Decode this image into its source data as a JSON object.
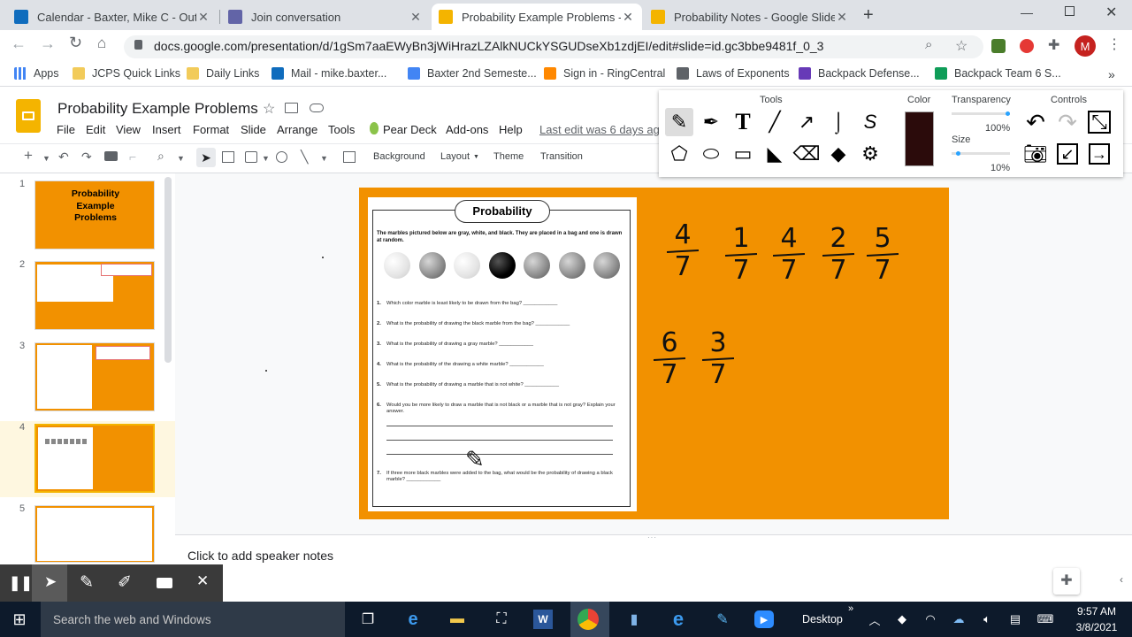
{
  "browser": {
    "tabs": [
      {
        "title": "Calendar - Baxter, Mike C - Outlo",
        "icon_color": "#0f6cbd"
      },
      {
        "title": "Join conversation",
        "icon_color": "#6264a7"
      },
      {
        "title": "Probability Example Problems - G",
        "icon_color": "#f4b400"
      },
      {
        "title": "Probability Notes - Google Slides",
        "icon_color": "#f4b400"
      }
    ],
    "new_tab": "+",
    "url": "docs.google.com/presentation/d/1gSm7aaEWyBn3jWiHrazLZAlkNUCkYSGUDseXb1zdjEI/edit#slide=id.gc3bbe9481f_0_3",
    "profile_initial": "M",
    "bookmarks": [
      {
        "label": "Apps",
        "icon": "apps-grid-icon"
      },
      {
        "label": "JCPS Quick Links",
        "icon": "folder-icon"
      },
      {
        "label": "Daily Links",
        "icon": "folder-icon"
      },
      {
        "label": "Mail - mike.baxter...",
        "icon": "outlook-icon"
      },
      {
        "label": "Baxter 2nd Semeste...",
        "icon": "docs-icon"
      },
      {
        "label": "Sign in - RingCentral",
        "icon": "ringcentral-icon"
      },
      {
        "label": "Laws of Exponents",
        "icon": "pearson-icon"
      },
      {
        "label": "Backpack Defense...",
        "icon": "forms-icon"
      },
      {
        "label": "Backpack Team 6 S...",
        "icon": "sheets-icon"
      }
    ],
    "more": "»"
  },
  "slides": {
    "doc_title": "Probability Example Problems",
    "menus": [
      "File",
      "Edit",
      "View",
      "Insert",
      "Format",
      "Slide",
      "Arrange",
      "Tools",
      "Pear Deck",
      "Add-ons",
      "Help"
    ],
    "last_edit": "Last edit was 6 days ago",
    "toolbar_text_buttons": [
      "Background",
      "Layout",
      "Theme",
      "Transition"
    ],
    "filmstrip": [
      {
        "num": "1",
        "title": "Probability Example Problems"
      },
      {
        "num": "2"
      },
      {
        "num": "3"
      },
      {
        "num": "4"
      },
      {
        "num": "5"
      }
    ],
    "speaker_notes_placeholder": "Click to add speaker notes",
    "worksheet": {
      "title": "Probability",
      "intro": "The marbles pictured below are gray, white, and black.  They are placed in a bag and one is drawn at random.",
      "marbles": [
        "white",
        "gray",
        "white",
        "black",
        "gray",
        "gray",
        "gray"
      ],
      "questions": [
        {
          "n": "1.",
          "text": "Which color marble is least likely to be drawn from the bag? ____________"
        },
        {
          "n": "2.",
          "text": "What is the probability of drawing the black marble from the bag? ____________"
        },
        {
          "n": "3.",
          "text": "What is the probability of drawing a gray marble? ____________"
        },
        {
          "n": "4.",
          "text": "What is the probability of the drawing a white marble? ____________"
        },
        {
          "n": "5.",
          "text": "What is the probability of drawing a marble that is not white? ____________"
        },
        {
          "n": "6.",
          "text": "Would you be more likely to draw a marble that is not black or a marble that is not gray? Explain your answer."
        },
        {
          "n": "7.",
          "text": "If three more black marbles were added to the bag, what would be the probability of drawing a black marble? ____________"
        }
      ]
    },
    "handwritten_fractions": [
      {
        "num": "4",
        "den": "7"
      },
      {
        "num": "1",
        "den": "7"
      },
      {
        "num": "4",
        "den": "7"
      },
      {
        "num": "2",
        "den": "7"
      },
      {
        "num": "5",
        "den": "7"
      },
      {
        "num": "6",
        "den": "7"
      },
      {
        "num": "3",
        "den": "7"
      }
    ]
  },
  "pear_deck_panel": {
    "tools_label": "Tools",
    "color_label": "Color",
    "transparency_label": "Transparency",
    "transparency_value": "100%",
    "size_label": "Size",
    "size_value": "10%",
    "controls_label": "Controls",
    "selected_color": "#2b0b0b"
  },
  "recorder_bar": {
    "buttons": [
      "pause-icon",
      "pointer-icon",
      "pen-icon",
      "highlighter-icon",
      "camera-icon",
      "close-icon"
    ]
  },
  "taskbar": {
    "search_placeholder": "Search the web and Windows",
    "desktop_label": "Desktop",
    "time": "9:57 AM",
    "date": "3/8/2021"
  }
}
